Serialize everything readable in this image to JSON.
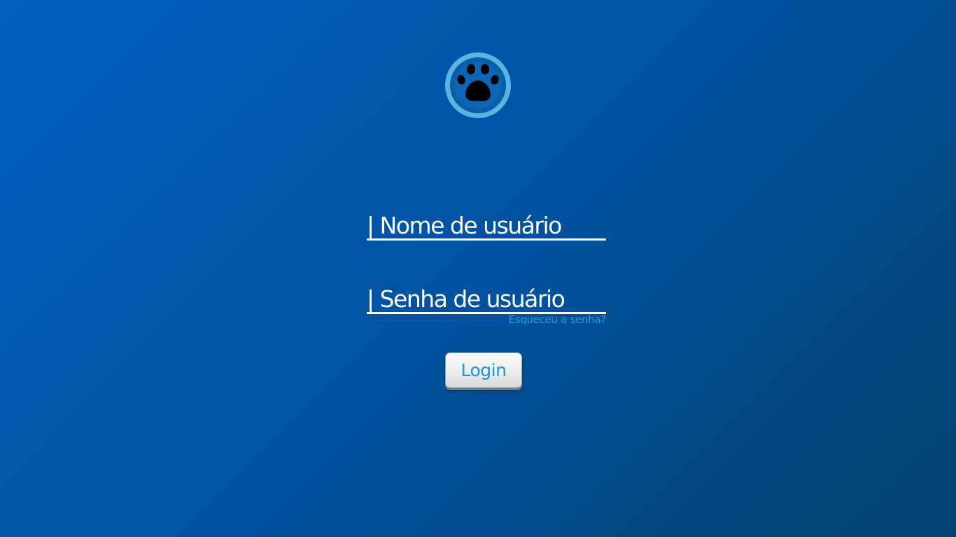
{
  "logo": {
    "icon": "paw-icon",
    "ring_color": "#5bb4e0",
    "inner_color": "#0a5da8",
    "paw_color": "#000000"
  },
  "form": {
    "username_placeholder": "| Nome de usuário",
    "password_placeholder": "| Senha de usuário",
    "forgot_password": "Esqueceu a senha?",
    "login_label": "Login"
  },
  "colors": {
    "accent": "#1a96d8",
    "field_underline": "#ffffff"
  }
}
